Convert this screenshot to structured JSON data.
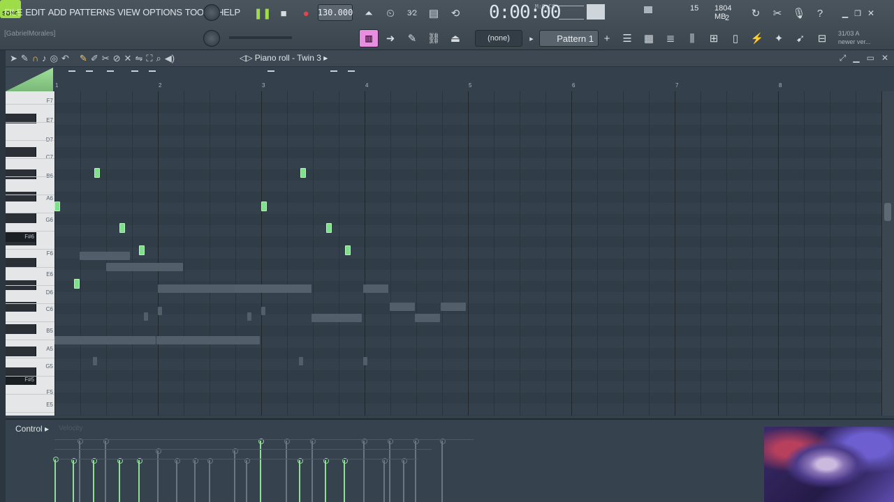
{
  "menu": [
    "FILE",
    "EDIT",
    "ADD",
    "PATTERNS",
    "VIEW",
    "OPTIONS",
    "TOOLS",
    "HELP"
  ],
  "user_label": "[GabrielMorales]",
  "transport": {
    "mode": "SONG",
    "tempo": "130.000",
    "time": "0:00:00",
    "time_unit": "M:S:CS"
  },
  "cpu": {
    "value1": "15",
    "memory": "1804 MB",
    "polyphony": "2"
  },
  "channel_select": "(none)",
  "pattern": "Pattern 1",
  "news": {
    "date": "31/03",
    "line1": "A",
    "line2": "newer ver..."
  },
  "window": {
    "title": "Piano roll - Twin 3"
  },
  "ruler": [
    "1",
    "2",
    "3",
    "4",
    "5",
    "6",
    "7",
    "8"
  ],
  "key_labels": [
    "G7",
    "F#7",
    "F7",
    "E7",
    "D7",
    "C7",
    "B6",
    "A6",
    "G6",
    "F#6",
    "F6",
    "E6",
    "D6",
    "C6",
    "B5",
    "A5",
    "G5",
    "F#5",
    "F5",
    "E5"
  ],
  "control": {
    "label": "Control",
    "sublabel": "Velocity"
  },
  "colors": {
    "note": "#7ee08a",
    "accent": "#9fdc4a",
    "grid_bg": "#34414c",
    "key_highlight": "#1a1f24"
  }
}
